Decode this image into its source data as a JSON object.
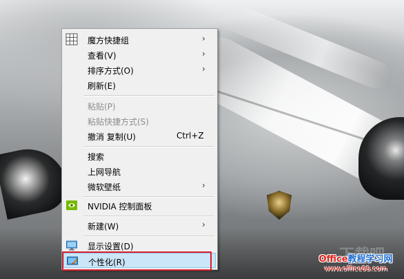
{
  "menu": {
    "items": [
      {
        "label": "魔方快捷组",
        "arrow": "›",
        "icon": "grid-icon"
      },
      {
        "label": "查看(V)",
        "arrow": "›"
      },
      {
        "label": "排序方式(O)",
        "arrow": "›"
      },
      {
        "label": "刷新(E)"
      },
      {
        "label": "粘贴(P)",
        "disabled": true
      },
      {
        "label": "粘贴快捷方式(S)",
        "disabled": true
      },
      {
        "label": "撤消 复制(U)",
        "shortcut": "Ctrl+Z"
      },
      {
        "label": "搜索"
      },
      {
        "label": "上网导航"
      },
      {
        "label": "微软壁纸",
        "arrow": "›"
      },
      {
        "label": "NVIDIA 控制面板",
        "icon": "nvidia-icon"
      },
      {
        "label": "新建(W)",
        "arrow": "›"
      },
      {
        "label": "显示设置(D)",
        "icon": "display-icon"
      },
      {
        "label": "个性化(R)",
        "icon": "personalize-icon",
        "highlighted": true
      }
    ]
  },
  "watermark": {
    "site_top_a": "Office",
    "site_top_b": "教程学习网",
    "site_bottom": "www.office68.com",
    "faint": "下载吧"
  },
  "colors": {
    "highlight_bg": "#cbe6f7",
    "annotation_box": "#d81e2a",
    "menu_bg": "#f0f0f0"
  }
}
